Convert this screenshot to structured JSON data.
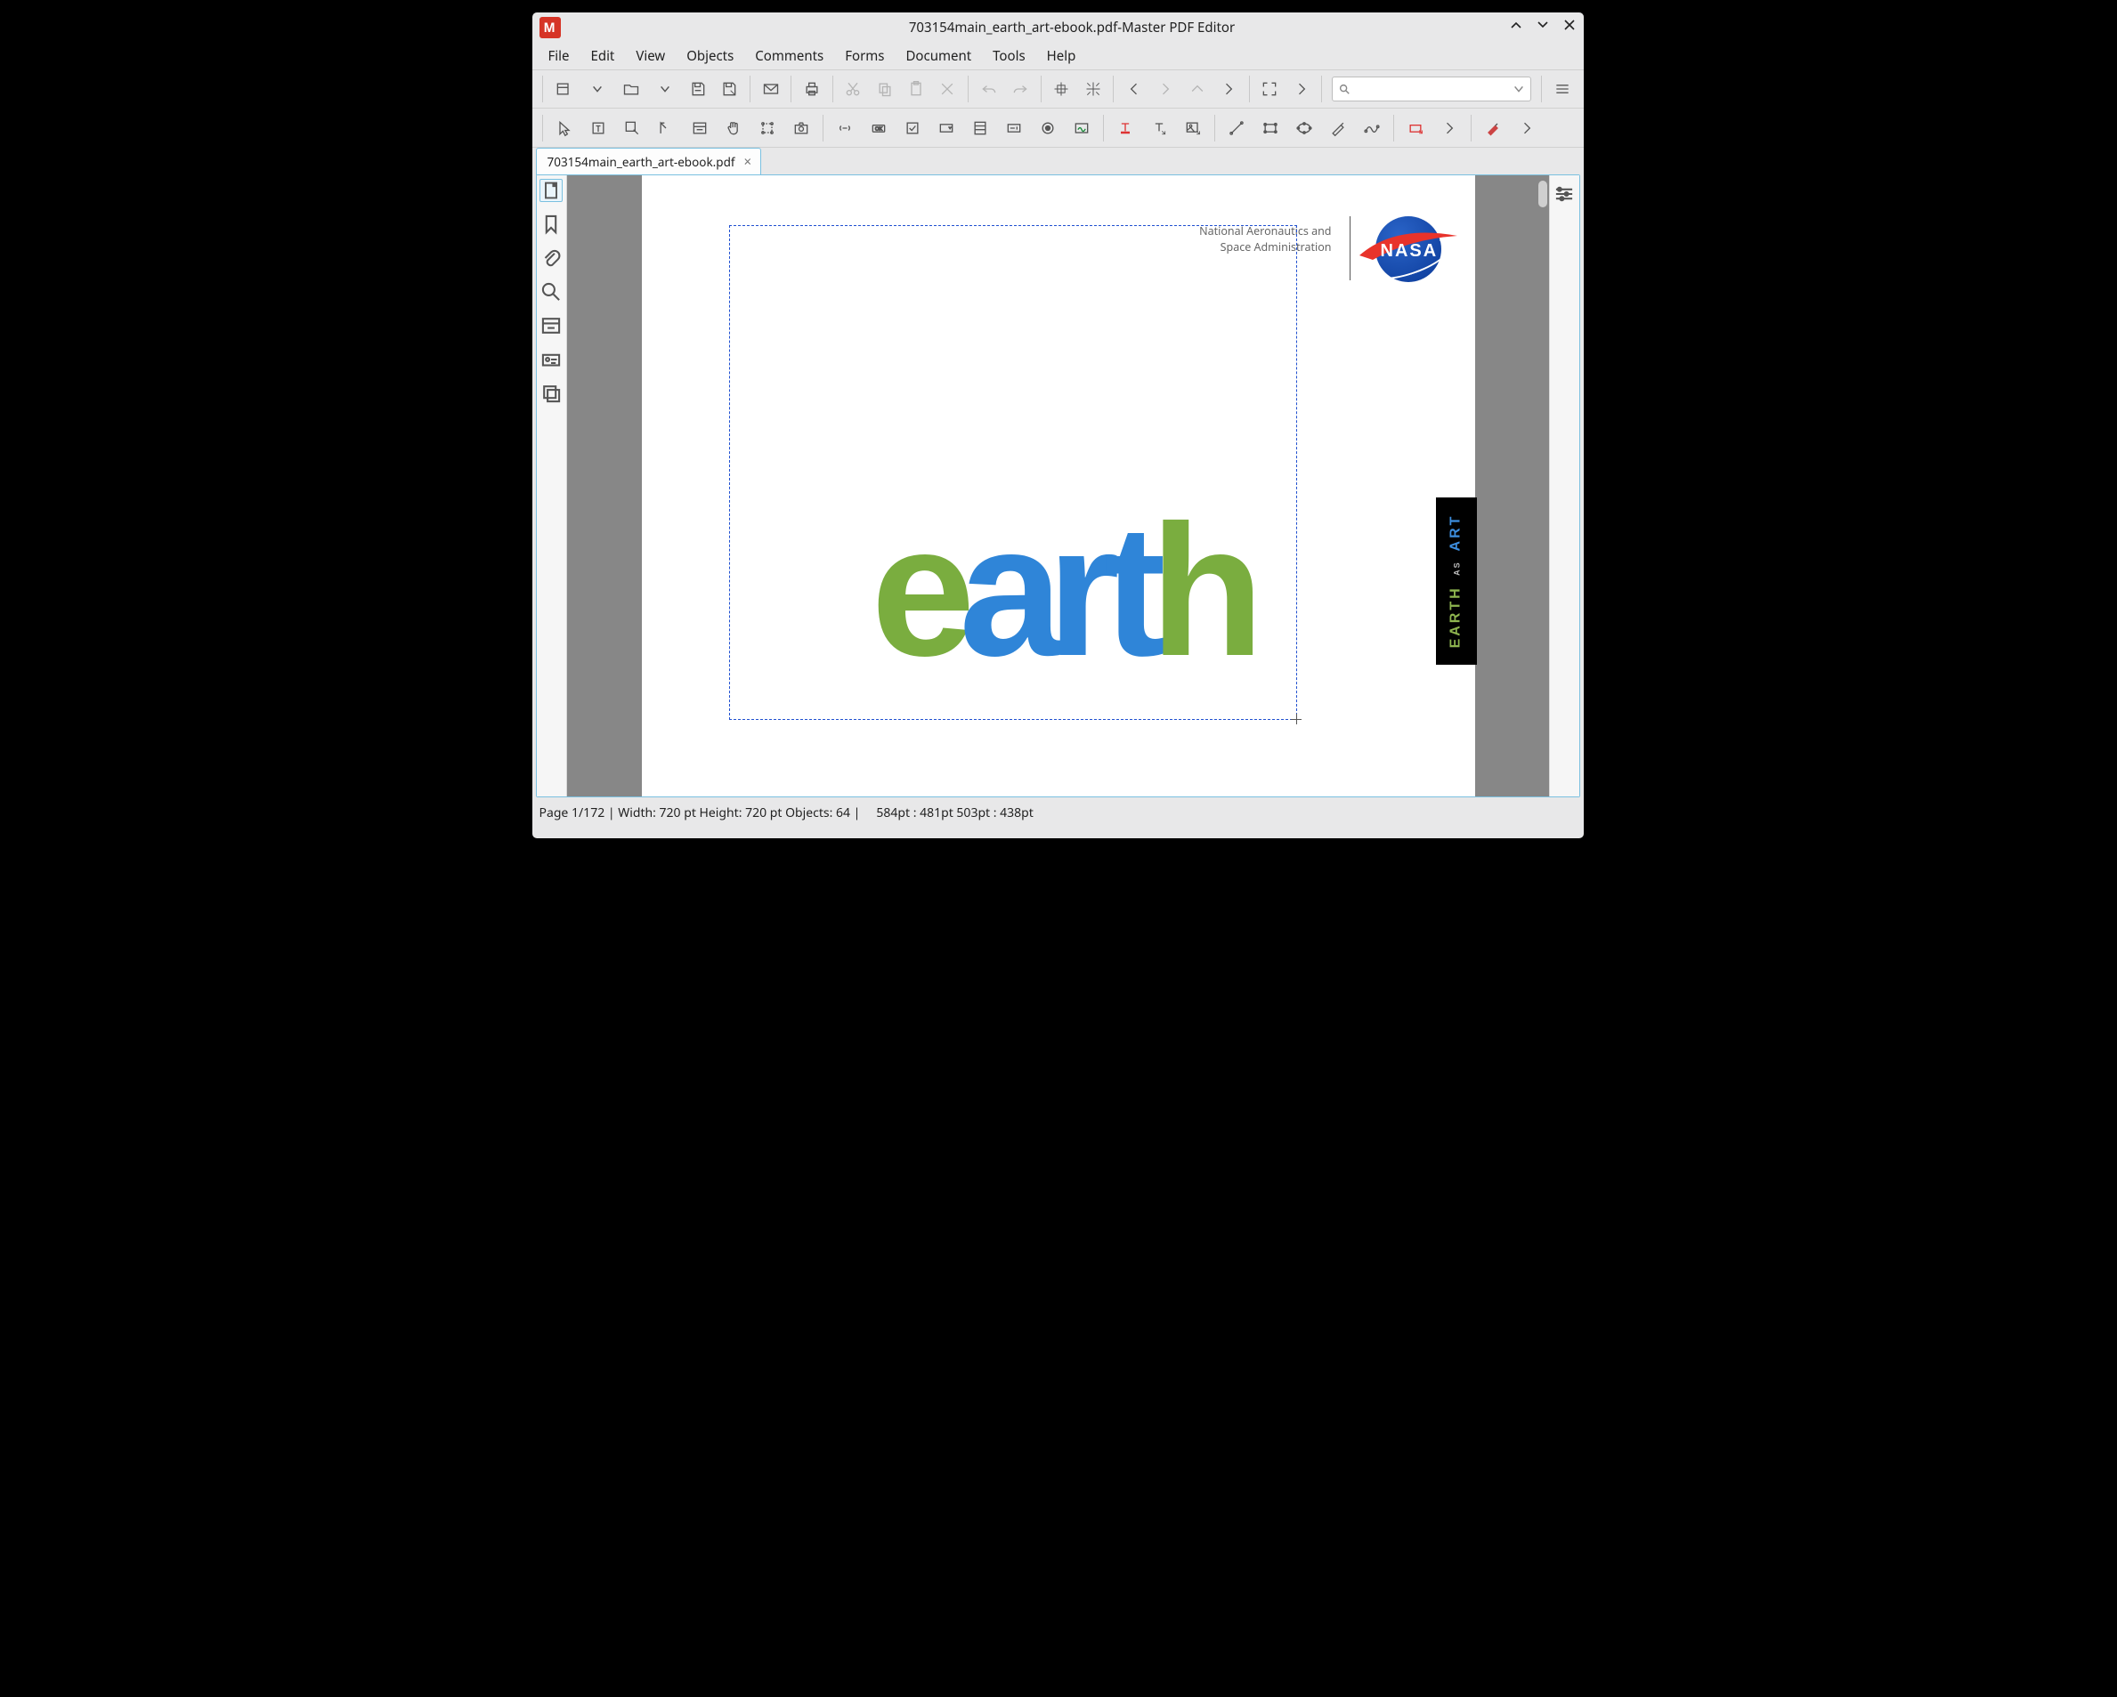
{
  "window": {
    "title": "703154main_earth_art-ebook.pdf-Master PDF Editor"
  },
  "menu": [
    "File",
    "Edit",
    "View",
    "Objects",
    "Comments",
    "Forms",
    "Document",
    "Tools",
    "Help"
  ],
  "toolbar": {
    "search_placeholder": ""
  },
  "tabs": [
    {
      "label": "703154main_earth_art-ebook.pdf"
    }
  ],
  "document": {
    "header": {
      "line1": "National Aeronautics and",
      "line2": "Space Administration",
      "logo_text": "NASA"
    },
    "wordmark": [
      "e",
      "art",
      "h"
    ],
    "sidetab": [
      "EARTH",
      "AS",
      "ART"
    ]
  },
  "status": {
    "left": "Page 1/172 | Width: 720 pt Height: 720 pt Objects: 64    |",
    "right": "584pt : 481pt  503pt : 438pt"
  }
}
